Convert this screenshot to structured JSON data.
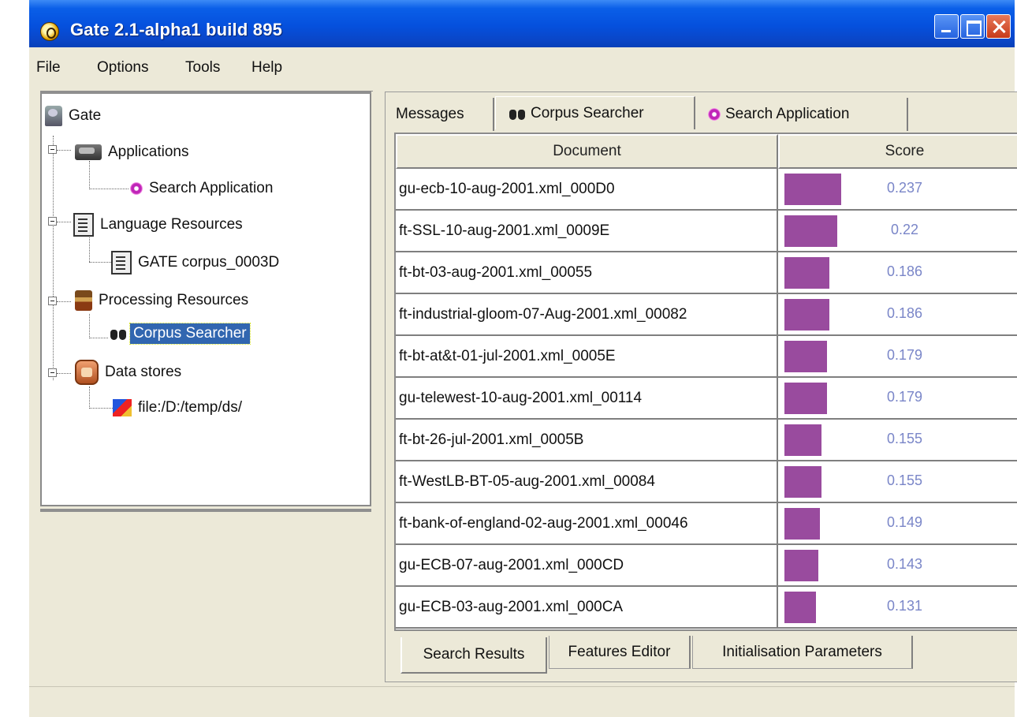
{
  "window": {
    "title": "Gate 2.1-alpha1 build 895",
    "controls": {
      "minimize": "minimize-icon",
      "maximize": "maximize-icon",
      "close": "close-icon"
    }
  },
  "menubar": {
    "items": [
      "File",
      "Options",
      "Tools",
      "Help"
    ]
  },
  "tree": {
    "root": "Gate",
    "applications": {
      "label": "Applications",
      "children": [
        "Search Application"
      ]
    },
    "language_resources": {
      "label": "Language Resources",
      "children": [
        "GATE corpus_0003D"
      ]
    },
    "processing_resources": {
      "label": "Processing Resources",
      "children": [
        "Corpus Searcher"
      ]
    },
    "data_stores": {
      "label": "Data stores",
      "children": [
        "file:/D:/temp/ds/"
      ]
    },
    "selected": "Corpus Searcher"
  },
  "top_tabs": [
    {
      "label": "Messages",
      "selected": false
    },
    {
      "label": "Corpus Searcher",
      "selected": true
    },
    {
      "label": "Search Application",
      "selected": false
    }
  ],
  "results_table": {
    "columns": [
      "Document",
      "Score"
    ],
    "max_score_ref": 0.237,
    "bar_color": "#994b9e",
    "score_color": "#7a86c8",
    "rows": [
      {
        "document": "gu-ecb-10-aug-2001.xml_000D0",
        "score": "0.237",
        "value": 0.237
      },
      {
        "document": "ft-SSL-10-aug-2001.xml_0009E",
        "score": "0.22",
        "value": 0.22
      },
      {
        "document": "ft-bt-03-aug-2001.xml_00055",
        "score": "0.186",
        "value": 0.186
      },
      {
        "document": "ft-industrial-gloom-07-Aug-2001.xml_00082",
        "score": "0.186",
        "value": 0.186
      },
      {
        "document": "ft-bt-at&t-01-jul-2001.xml_0005E",
        "score": "0.179",
        "value": 0.179
      },
      {
        "document": "gu-telewest-10-aug-2001.xml_00114",
        "score": "0.179",
        "value": 0.179
      },
      {
        "document": "ft-bt-26-jul-2001.xml_0005B",
        "score": "0.155",
        "value": 0.155
      },
      {
        "document": "ft-WestLB-BT-05-aug-2001.xml_00084",
        "score": "0.155",
        "value": 0.155
      },
      {
        "document": "ft-bank-of-england-02-aug-2001.xml_00046",
        "score": "0.149",
        "value": 0.149
      },
      {
        "document": "gu-ECB-07-aug-2001.xml_000CD",
        "score": "0.143",
        "value": 0.143
      },
      {
        "document": "gu-ECB-03-aug-2001.xml_000CA",
        "score": "0.131",
        "value": 0.131
      }
    ]
  },
  "bottom_tabs": [
    {
      "label": "Search Results",
      "selected": true
    },
    {
      "label": "Features Editor",
      "selected": false
    },
    {
      "label": "Initialisation Parameters",
      "selected": false
    }
  ]
}
